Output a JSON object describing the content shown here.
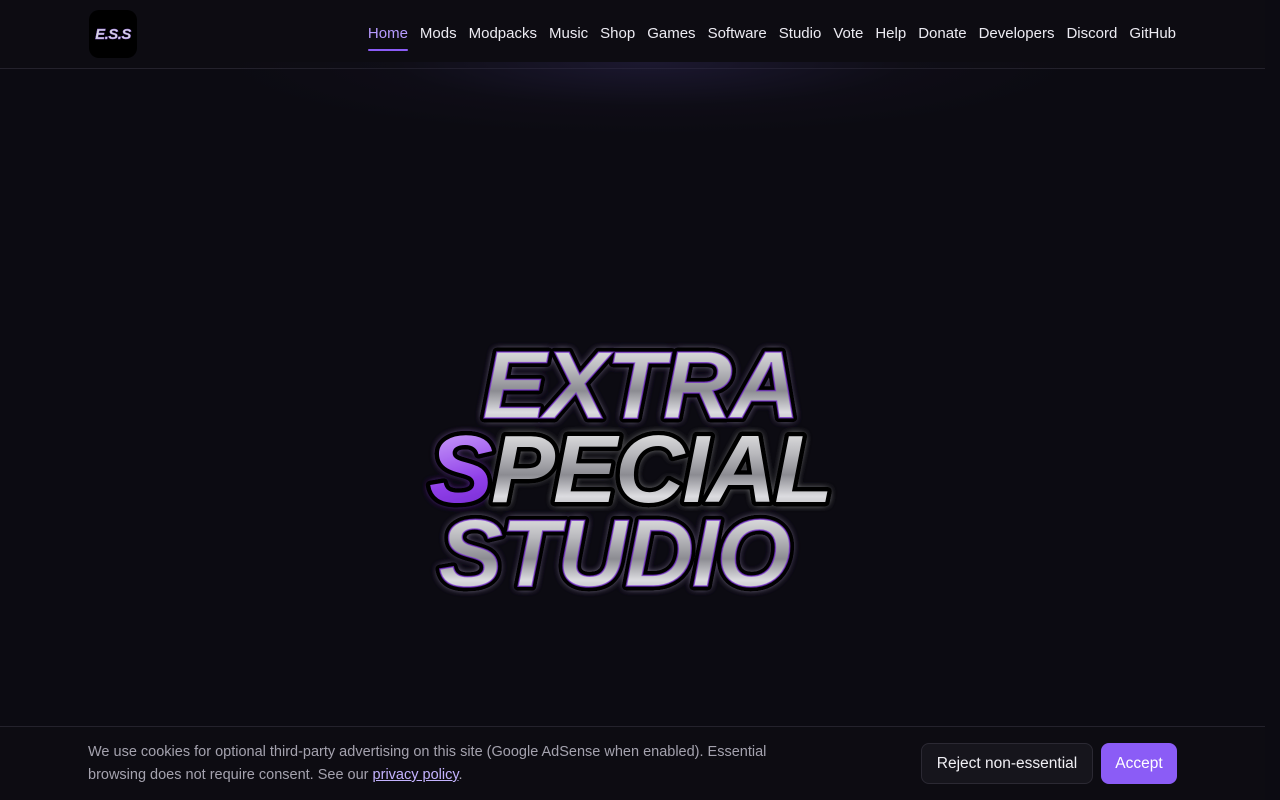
{
  "header": {
    "logo_text": "E.S.S",
    "nav": [
      {
        "label": "Home",
        "active": true
      },
      {
        "label": "Mods"
      },
      {
        "label": "Modpacks"
      },
      {
        "label": "Music"
      },
      {
        "label": "Shop"
      },
      {
        "label": "Games"
      },
      {
        "label": "Software"
      },
      {
        "label": "Studio"
      },
      {
        "label": "Vote"
      },
      {
        "label": "Help"
      },
      {
        "label": "Donate"
      },
      {
        "label": "Developers"
      },
      {
        "label": "Discord"
      },
      {
        "label": "GitHub"
      }
    ]
  },
  "hero": {
    "line1": "EXTRA",
    "line2_accent": "S",
    "line2_rest": "PECIAL",
    "line3": "STUDIO"
  },
  "cookie_banner": {
    "text": "We use cookies for optional third-party advertising on this site (Google AdSense when enabled). Essential browsing does not require consent. See our ",
    "link_text": "privacy policy",
    "text_end": ".",
    "reject_label": "Reject non-essential",
    "accept_label": "Accept"
  },
  "colors": {
    "background": "#0c0b12",
    "accent": "#8b5cf6",
    "accent_text": "#b79bff",
    "logo_glow": "#7b2fd6"
  }
}
